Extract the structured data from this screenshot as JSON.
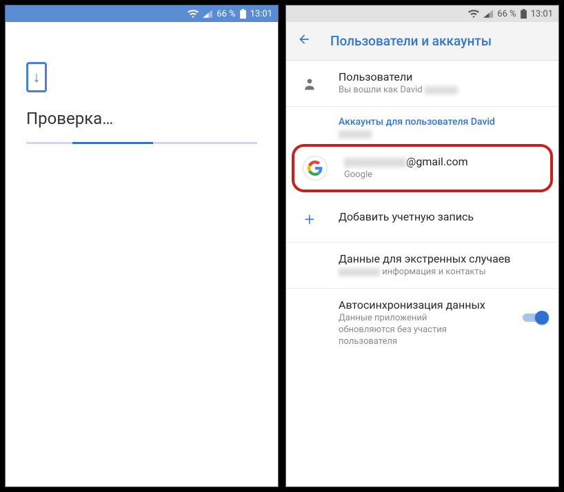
{
  "status": {
    "battery_pct": "66 %",
    "time": "13:01"
  },
  "left": {
    "title": "Проверка…"
  },
  "right": {
    "header_title": "Пользователи и аккаунты",
    "users": {
      "title": "Пользователи",
      "sub_prefix": "Вы вошли как David "
    },
    "section_prefix": "Аккаунты для пользователя David",
    "account": {
      "email_suffix": "@gmail.com",
      "provider": "Google"
    },
    "add_account": "Добавить учетную запись",
    "emergency": {
      "title": "Данные для экстренных случаев",
      "sub_suffix": " информация и контакты"
    },
    "autosync": {
      "title": "Автосинхронизация данных",
      "sub": "Данные приложений обновляются без участия пользователя"
    }
  }
}
